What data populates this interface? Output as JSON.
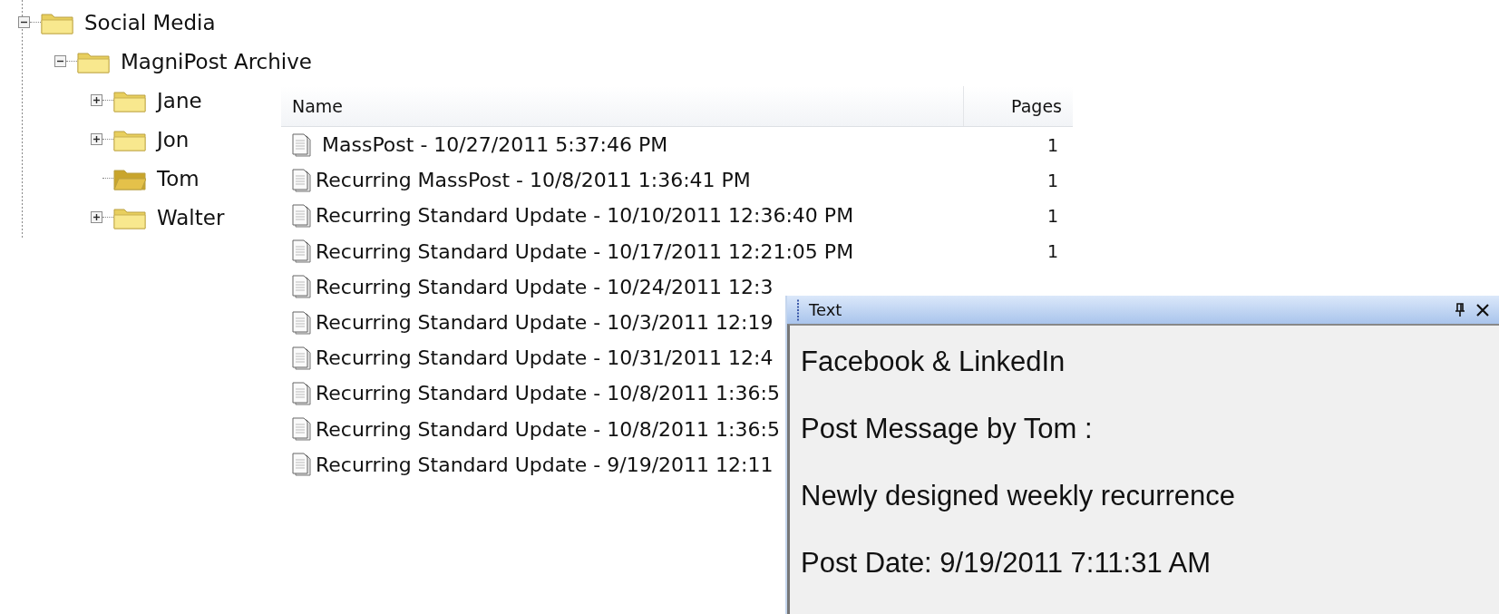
{
  "tree": [
    {
      "label": "Social Media",
      "expanded": true,
      "selected": false,
      "children": [
        {
          "label": "MagniPost Archive",
          "expanded": true,
          "selected": false,
          "children": [
            {
              "label": "Jane",
              "expanded": false,
              "selected": false
            },
            {
              "label": "Jon",
              "expanded": false,
              "selected": false
            },
            {
              "label": "Tom",
              "selected": true
            },
            {
              "label": "Walter",
              "expanded": false,
              "selected": false
            }
          ]
        }
      ]
    }
  ],
  "table": {
    "columns": [
      "Name",
      "Pages"
    ],
    "rows": [
      {
        "name": " MassPost - 10/27/2011 5:37:46 PM",
        "pages": "1"
      },
      {
        "name": "Recurring MassPost - 10/8/2011 1:36:41 PM",
        "pages": "1"
      },
      {
        "name": "Recurring Standard Update - 10/10/2011 12:36:40 PM",
        "pages": "1"
      },
      {
        "name": "Recurring Standard Update - 10/17/2011 12:21:05 PM",
        "pages": "1"
      },
      {
        "name": "Recurring Standard Update - 10/24/2011 12:3"
      },
      {
        "name": "Recurring Standard Update - 10/3/2011 12:19"
      },
      {
        "name": "Recurring Standard Update - 10/31/2011 12:4"
      },
      {
        "name": "Recurring Standard Update - 10/8/2011 1:36:5"
      },
      {
        "name": "Recurring Standard Update - 10/8/2011 1:36:5"
      },
      {
        "name": "Recurring Standard Update - 9/19/2011 12:11"
      }
    ]
  },
  "text_panel": {
    "title": "Text",
    "lines": [
      "Facebook & LinkedIn",
      "Post Message by Tom :",
      "Newly designed weekly recurrence",
      "Post Date: 9/19/2011 7:11:31 AM"
    ]
  }
}
